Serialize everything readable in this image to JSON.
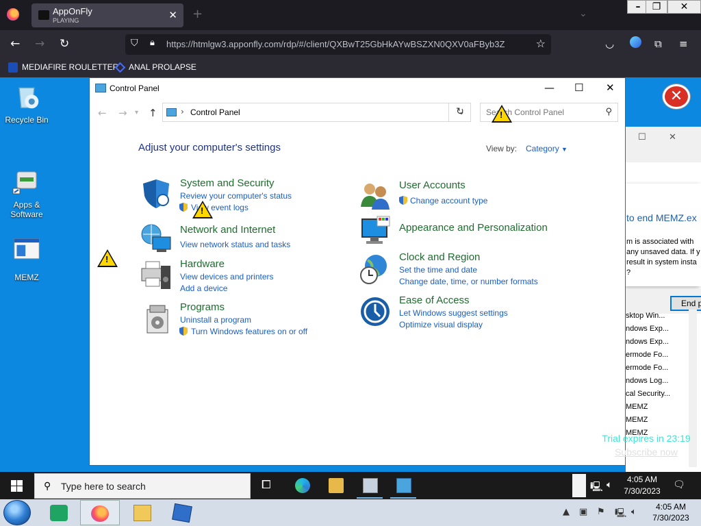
{
  "browser": {
    "tab_title": "AppOnFly",
    "tab_subtitle": "PLAYING",
    "url": "https://htmlgw3.apponfly.com/rdp/#/client/QXBwT25GbHkAYwBSZXN0QXV0aFByb3Z",
    "bookmarks": [
      {
        "label": "MEDIAFIRE ROULETTER"
      },
      {
        "label": "ANAL PROLAPSE"
      }
    ]
  },
  "desktop": {
    "icons": [
      {
        "label": "Recycle Bin"
      },
      {
        "label": "Apps & Software"
      },
      {
        "label": "MEMZ"
      }
    ]
  },
  "control_panel": {
    "window_title": "Control Panel",
    "address": "Control Panel",
    "search_placeholder": "Search Control Panel",
    "heading": "Adjust your computer's settings",
    "view_by_label": "View by:",
    "view_by_value": "Category",
    "categories": [
      {
        "title": "System and Security",
        "links": [
          "Review your computer's status",
          "View event logs"
        ]
      },
      {
        "title": "Network and Internet",
        "links": [
          "View network status and tasks"
        ]
      },
      {
        "title": "Hardware",
        "links": [
          "View devices and printers",
          "Add a device"
        ]
      },
      {
        "title": "Programs",
        "links": [
          "Uninstall a program",
          "Turn Windows features on or off"
        ]
      },
      {
        "title": "User Accounts",
        "links": [
          "Change account type"
        ]
      },
      {
        "title": "Appearance and Personalization",
        "links": []
      },
      {
        "title": "Clock and Region",
        "links": [
          "Set the time and date",
          "Change date, time, or number formats"
        ]
      },
      {
        "title": "Ease of Access",
        "links": [
          "Let Windows suggest settings",
          "Optimize visual display"
        ]
      }
    ]
  },
  "end_task_dialog": {
    "title": "to end MEMZ.ex",
    "body": [
      "m is associated with",
      "any unsaved data. If y",
      "result in system insta",
      "?"
    ],
    "button": "End p"
  },
  "process_list": [
    "sktop Win...",
    "ndows Exp...",
    "ndows Exp...",
    "ermode Fo...",
    "ermode Fo...",
    "ndows Log...",
    "cal Security...",
    "MEMZ",
    "MEMZ",
    "MEMZ"
  ],
  "trial": {
    "text": "Trial expires in 23:19",
    "link": "Subscribe now"
  },
  "remote_taskbar": {
    "search_placeholder": "Type here to search",
    "time": "4:05 AM",
    "date": "7/30/2023"
  },
  "local_taskbar": {
    "time": "4:05 AM",
    "date": "7/30/2023"
  },
  "colors": {
    "desktop": "#0d88e0",
    "cp_heading": "#1e3287",
    "cp_category": "#1d6d2e",
    "cp_link": "#1a5ec4",
    "trial": "#37e8d8"
  }
}
